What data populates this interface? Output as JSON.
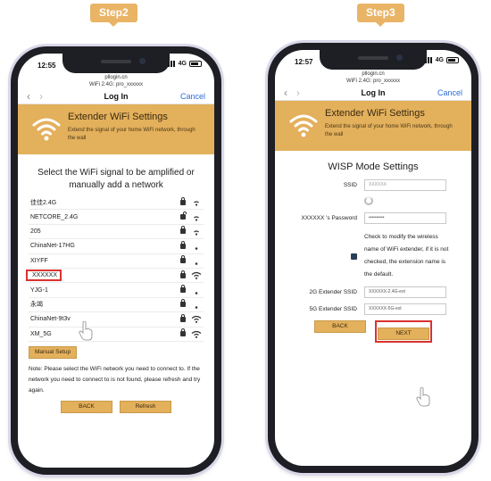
{
  "steps": {
    "left": "Step2",
    "right": "Step3"
  },
  "status": {
    "left_time": "12:55",
    "right_time": "12:57",
    "network": "4G"
  },
  "browser": {
    "url": "pllogin.cn",
    "left_page": "WiFi 2.4G: pro_xxxxxx",
    "right_page": "WiFi 2.4G: pro_xxxxxx",
    "title": "Log In",
    "cancel": "Cancel"
  },
  "banner": {
    "title": "Extender WiFi Settings",
    "desc": "Extend the signal of your home WiFi network, through the wall"
  },
  "select": {
    "heading": "Select the WiFi signal to be amplified or manually add a network",
    "networks": [
      {
        "name": "佳佳2.4G",
        "lock": "locked",
        "signal": "weak"
      },
      {
        "name": "NETCORE_2.4G",
        "lock": "open",
        "signal": "weak"
      },
      {
        "name": "205",
        "lock": "locked",
        "signal": "weak"
      },
      {
        "name": "ChinaNet-17HG",
        "lock": "locked",
        "signal": "dot"
      },
      {
        "name": "XIYFF",
        "lock": "locked",
        "signal": "dot"
      },
      {
        "name": "XXXXXX",
        "lock": "locked",
        "signal": "strong"
      },
      {
        "name": "YJG-1",
        "lock": "locked",
        "signal": "dot"
      },
      {
        "name": "永竭",
        "lock": "locked",
        "signal": "dot"
      },
      {
        "name": "ChinaNet-9t3v",
        "lock": "locked",
        "signal": "strong"
      },
      {
        "name": "XM_5G",
        "lock": "locked",
        "signal": "strong"
      }
    ],
    "manual_setup": "Manual Setup",
    "note": "Note: Please select the WiFi network you need to connect to. If the network you need to connect to is not found, please refresh and try again.",
    "back": "BACK",
    "refresh": "Refresh"
  },
  "wisp": {
    "title": "WISP Mode Settings",
    "ssid_label": "SSID",
    "ssid_value": "XXXXXX",
    "password_label": "XXXXXX 's Password",
    "password_value": "••••••••••",
    "checkbox_text": "Check to modify the wireless name of WiFi extender, if it is not checked, the extension name is the default.",
    "ssid_2g_label": "2G Extender SSID",
    "ssid_2g_value": "XXXXXX-2.4G-ext",
    "ssid_5g_label": "5G Extender SSID",
    "ssid_5g_value": "XXXXXX-5G-ext",
    "back": "BACK",
    "next": "NEXT"
  },
  "colors": {
    "accent": "#e3b05c",
    "highlight": "#d9322f",
    "link": "#2f6bd8"
  }
}
